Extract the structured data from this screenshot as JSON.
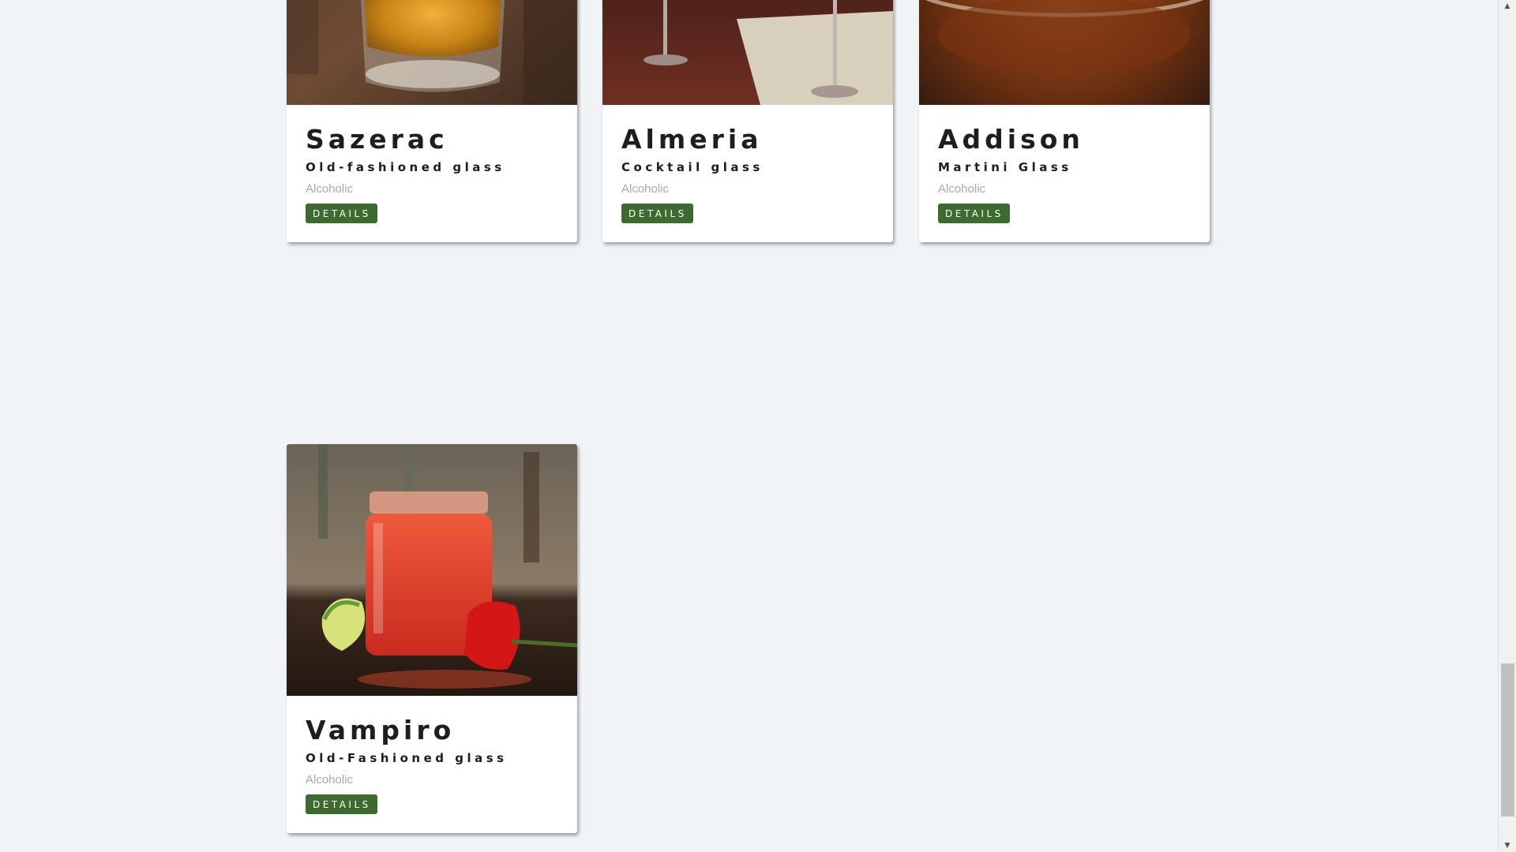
{
  "drinks": [
    {
      "name": "Sazerac",
      "glass": "Old-fashioned glass",
      "type": "Alcoholic",
      "button": "DETAILS"
    },
    {
      "name": "Almeria",
      "glass": "Cocktail glass",
      "type": "Alcoholic",
      "button": "DETAILS"
    },
    {
      "name": "Addison",
      "glass": "Martini Glass",
      "type": "Alcoholic",
      "button": "DETAILS"
    },
    {
      "name": "Vampiro",
      "glass": "Old-Fashioned glass",
      "type": "Alcoholic",
      "button": "DETAILS"
    }
  ],
  "colors": {
    "page_background": "#f0f4f7",
    "button": "#3c6a2f",
    "title": "#1e1e1e",
    "muted": "#a9a9a9"
  },
  "scrollbar": {
    "up_icon": "triangle-up-icon",
    "down_icon": "triangle-down-icon",
    "up_glyph": "▲",
    "down_glyph": "▼"
  }
}
